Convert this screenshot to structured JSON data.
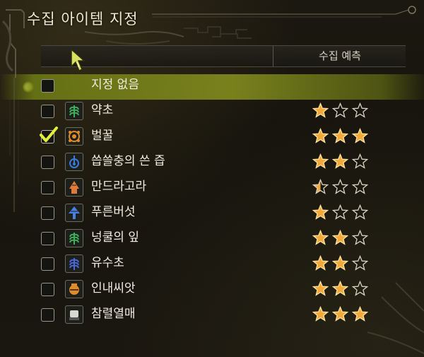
{
  "title": "수집 아이템 지정",
  "header": {
    "column_label": "수집 예측"
  },
  "rows": [
    {
      "label": "지정 없음",
      "checked": false,
      "highlighted": true,
      "icon": "none",
      "rating": null
    },
    {
      "label": "약초",
      "checked": false,
      "highlighted": false,
      "icon": "herb-icon",
      "icon_color": "#3fae5a",
      "rating": 1
    },
    {
      "label": "벌꿀",
      "checked": true,
      "highlighted": false,
      "icon": "honey-icon",
      "icon_color": "#e08a2c",
      "rating": 3
    },
    {
      "label": "씁쓸충의 쓴 즙",
      "checked": false,
      "highlighted": false,
      "icon": "bitterbug-icon",
      "icon_color": "#3a7ad8",
      "rating": 2
    },
    {
      "label": "만드라고라",
      "checked": false,
      "highlighted": false,
      "icon": "mandragora-icon",
      "icon_color": "#e07a3a",
      "rating": 0.5
    },
    {
      "label": "푸른버섯",
      "checked": false,
      "highlighted": false,
      "icon": "blue-mushroom-icon",
      "icon_color": "#4a7ee0",
      "rating": 1
    },
    {
      "label": "넝쿨의 잎",
      "checked": false,
      "highlighted": false,
      "icon": "ivy-icon",
      "icon_color": "#3fae5a",
      "rating": 2
    },
    {
      "label": "유수초",
      "checked": false,
      "highlighted": false,
      "icon": "stream-grass-icon",
      "icon_color": "#4a66d8",
      "rating": 2
    },
    {
      "label": "인내씨앗",
      "checked": false,
      "highlighted": false,
      "icon": "seed-icon",
      "icon_color": "#e08a2c",
      "rating": 2
    },
    {
      "label": "참렬열매",
      "checked": false,
      "highlighted": false,
      "icon": "nut-icon",
      "icon_color": "#d8d8d0",
      "rating": 3
    }
  ],
  "colors": {
    "star_fill": "#f2a93a",
    "star_outline": "#d8d2c2",
    "highlight": "#8c9620",
    "check": "#e2f03a"
  }
}
